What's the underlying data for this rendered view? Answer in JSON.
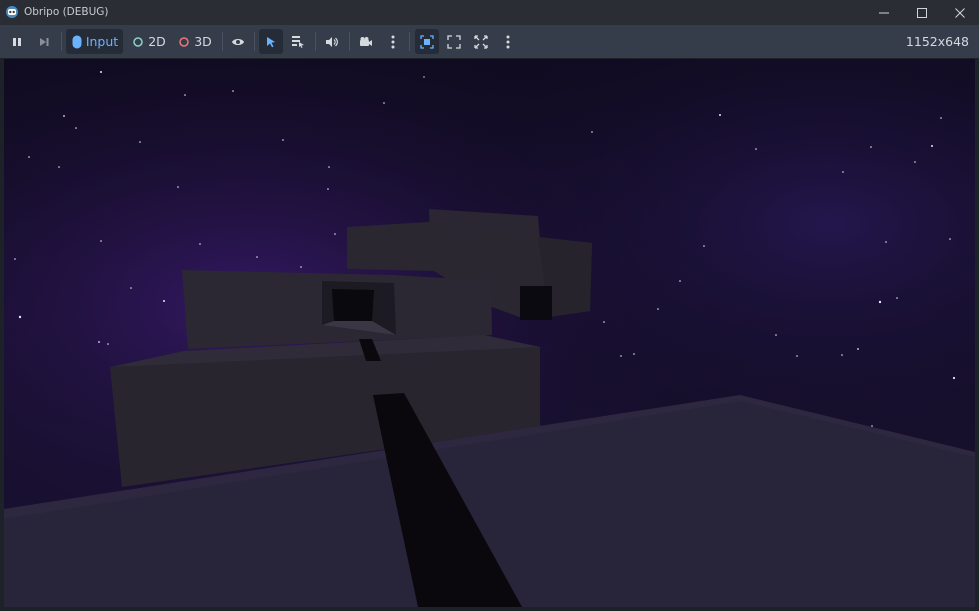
{
  "window": {
    "title": "Obripo (DEBUG)",
    "controls": [
      "minimize-icon",
      "maximize-icon",
      "close-icon"
    ]
  },
  "toolbar": {
    "input_label": "Input",
    "mode_2d_label": "2D",
    "mode_3d_label": "3D",
    "resolution": "1152x648",
    "icons": [
      "pause-icon",
      "next-frame-icon",
      "input-icon",
      "circle-2d-icon",
      "circle-3d-icon",
      "visibility-eye-icon",
      "select-arrow-icon",
      "list-select-icon",
      "speaker-icon",
      "camera-icon",
      "more-vertical-icon",
      "embed-window-icon",
      "expand-icon",
      "fullscreen-icon",
      "more-vertical-icon"
    ],
    "colors": {
      "accent": "#6ab4ff",
      "circle_2d": "#8fd1c6",
      "circle_3d": "#f07575"
    }
  },
  "scene": {
    "sky_color": "#1a1233",
    "nebula_color": "#3a1a6e",
    "floor_color": "#2a2535"
  }
}
